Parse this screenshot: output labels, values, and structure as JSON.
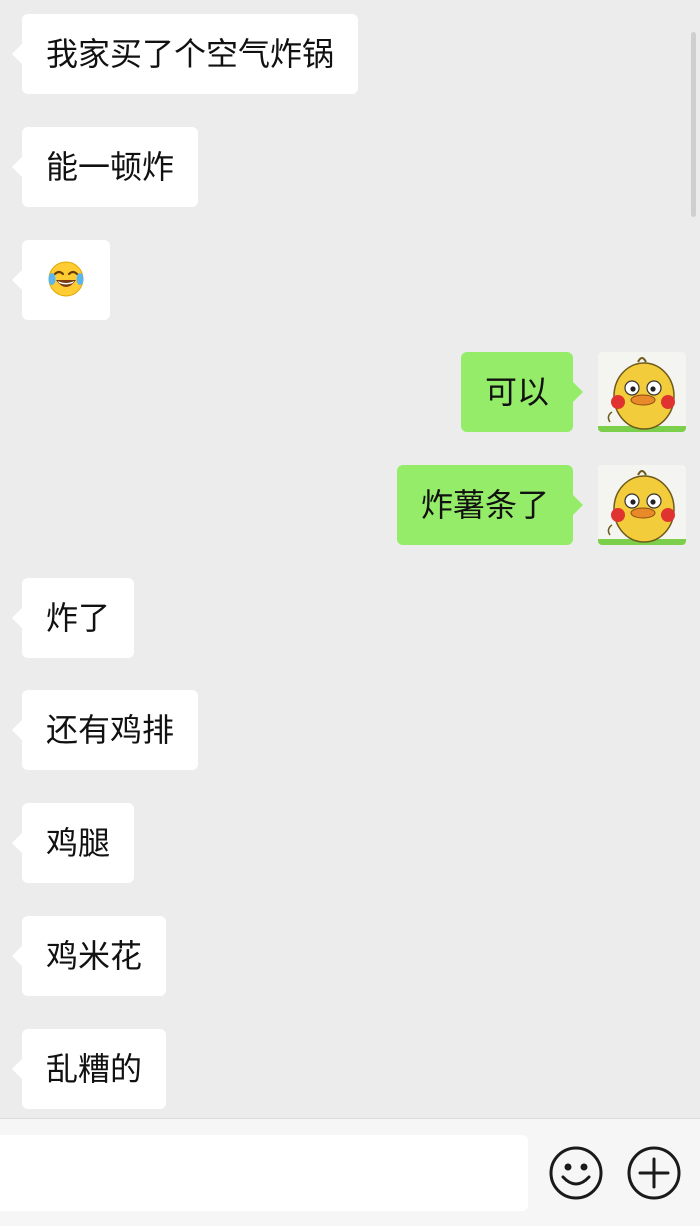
{
  "messages": [
    {
      "side": "in",
      "text": "我家买了个空气炸锅"
    },
    {
      "side": "in",
      "text": "能一顿炸"
    },
    {
      "side": "in",
      "emoji": "face-with-tears-of-joy-icon"
    },
    {
      "side": "out",
      "text": "可以"
    },
    {
      "side": "out",
      "text": "炸薯条了"
    },
    {
      "side": "in",
      "text": "炸了"
    },
    {
      "side": "in",
      "text": "还有鸡排"
    },
    {
      "side": "in",
      "text": "鸡腿"
    },
    {
      "side": "in",
      "text": "鸡米花"
    },
    {
      "side": "in",
      "text": "乱糟的"
    }
  ],
  "input_bar": {
    "value": "",
    "emoji_button_icon": "smiley-icon",
    "plus_button_icon": "plus-circle-icon"
  },
  "colors": {
    "background": "#ececec",
    "incoming_bubble": "#ffffff",
    "outgoing_bubble": "#95ec69",
    "avatar_body": "#f3cc3c",
    "avatar_cheek": "#e0332f"
  }
}
